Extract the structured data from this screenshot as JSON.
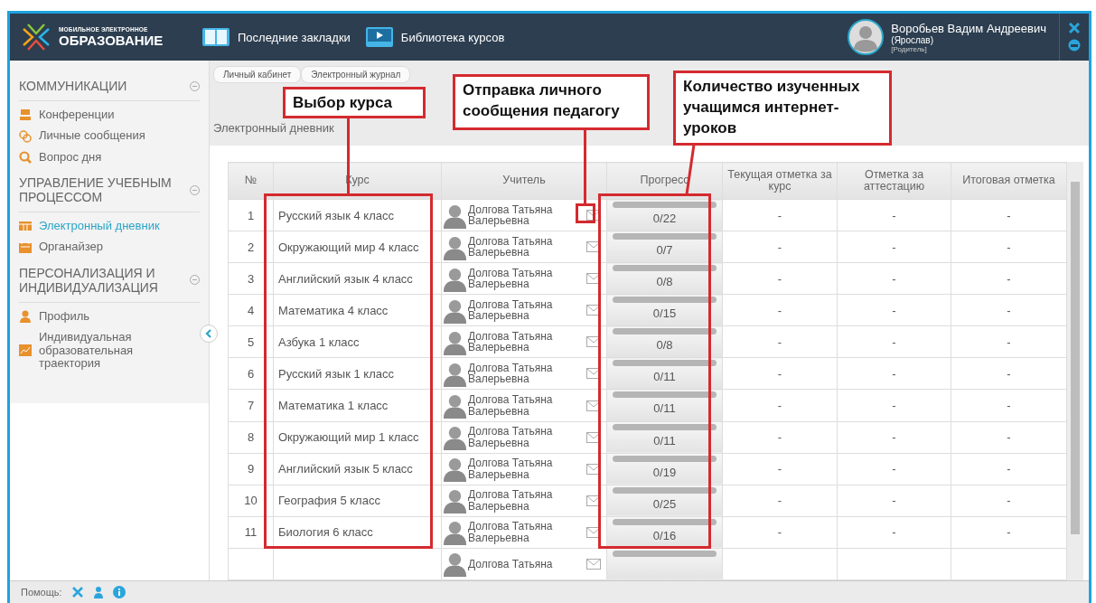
{
  "header": {
    "logo": {
      "line1": "МОБИЛЬНОЕ ЭЛЕКТРОННОЕ",
      "line2": "ОБРАЗОВАНИЕ"
    },
    "nav": [
      {
        "label": "Последние закладки",
        "kind": "book"
      },
      {
        "label": "Библиотека курсов",
        "kind": "video"
      }
    ],
    "user": {
      "name": "Воробьев Вадим Андреевич",
      "city": "(Ярослав)",
      "role": "[Родитель]"
    }
  },
  "sidebar": {
    "sections": [
      {
        "title": "КОММУНИКАЦИИ",
        "items": [
          {
            "label": "Конференции",
            "kind": "conference",
            "selected": false
          },
          {
            "label": "Личные сообщения",
            "kind": "chat",
            "selected": false
          },
          {
            "label": "Вопрос дня",
            "kind": "question",
            "selected": false
          }
        ]
      },
      {
        "title": "УПРАВЛЕНИЕ УЧЕБНЫМ ПРОЦЕССОМ",
        "items": [
          {
            "label": "Электронный дневник",
            "kind": "grid",
            "selected": true
          },
          {
            "label": "Органайзер",
            "kind": "calendar",
            "selected": false
          }
        ]
      },
      {
        "title": "ПЕРСОНАЛИЗАЦИЯ И ИНДИВИДУАЛИЗАЦИЯ",
        "items": [
          {
            "label": "Профиль",
            "kind": "person",
            "selected": false
          },
          {
            "label": "Индивидуальная образовательная траектория",
            "kind": "chart",
            "selected": false
          }
        ]
      }
    ]
  },
  "breadcrumb": [
    "Личный кабинет",
    "Электронный журнал"
  ],
  "page_title": "Электронный дневник",
  "table": {
    "columns": [
      "№",
      "Курс",
      "Учитель",
      "Прогресс",
      "Текущая отметка за курс",
      "Отметка за аттестацию",
      "Итоговая отметка"
    ],
    "rows": [
      {
        "number": "1",
        "course": "Русский язык 4 класс",
        "teacher": "Долгова Татьяна Валерьевна",
        "progress": {
          "level": 0,
          "reading": "0/22"
        },
        "current": "-",
        "attestation": "-",
        "final": "-"
      },
      {
        "number": "2",
        "course": "Окружающий мир 4 класс",
        "teacher": "Долгова Татьяна Валерьевна",
        "progress": {
          "level": 0,
          "reading": "0/7"
        },
        "current": "-",
        "attestation": "-",
        "final": "-"
      },
      {
        "number": "3",
        "course": "Английский язык 4 класс",
        "teacher": "Долгова Татьяна Валерьевна",
        "progress": {
          "level": 0,
          "reading": "0/8"
        },
        "current": "-",
        "attestation": "-",
        "final": "-"
      },
      {
        "number": "4",
        "course": "Математика 4 класс",
        "teacher": "Долгова Татьяна Валерьевна",
        "progress": {
          "level": 0,
          "reading": "0/15"
        },
        "current": "-",
        "attestation": "-",
        "final": "-"
      },
      {
        "number": "5",
        "course": "Азбука 1 класс",
        "teacher": "Долгова Татьяна Валерьевна",
        "progress": {
          "level": 0,
          "reading": "0/8"
        },
        "current": "-",
        "attestation": "-",
        "final": "-"
      },
      {
        "number": "6",
        "course": "Русский язык 1 класс",
        "teacher": "Долгова Татьяна Валерьевна",
        "progress": {
          "level": 0,
          "reading": "0/11"
        },
        "current": "-",
        "attestation": "-",
        "final": "-"
      },
      {
        "number": "7",
        "course": "Математика 1 класс",
        "teacher": "Долгова Татьяна Валерьевна",
        "progress": {
          "level": 0,
          "reading": "0/11"
        },
        "current": "-",
        "attestation": "-",
        "final": "-"
      },
      {
        "number": "8",
        "course": "Окружающий мир 1 класс",
        "teacher": "Долгова Татьяна Валерьевна",
        "progress": {
          "level": 0,
          "reading": "0/11"
        },
        "current": "-",
        "attestation": "-",
        "final": "-"
      },
      {
        "number": "9",
        "course": "Английский язык 5 класс",
        "teacher": "Долгова Татьяна Валерьевна",
        "progress": {
          "level": 0,
          "reading": "0/19"
        },
        "current": "-",
        "attestation": "-",
        "final": "-"
      },
      {
        "number": "10",
        "course": "География 5 класс",
        "teacher": "Долгова Татьяна Валерьевна",
        "progress": {
          "level": 0,
          "reading": "0/25"
        },
        "current": "-",
        "attestation": "-",
        "final": "-"
      },
      {
        "number": "11",
        "course": "Биология 6 класс",
        "teacher": "Долгова Татьяна Валерьевна",
        "progress": {
          "level": 0,
          "reading": "0/16"
        },
        "current": "-",
        "attestation": "-",
        "final": "-"
      },
      {
        "teacher": "Долгова Татьяна",
        "progress": {
          "level": 0
        }
      }
    ]
  },
  "footer": {
    "label": "Помощь:"
  },
  "annotations": [
    {
      "text": "Выбор курса"
    },
    {
      "text": "Отправка личного сообщения педагогу"
    },
    {
      "text": "Количество изученных учащимся интернет-уроков"
    }
  ]
}
